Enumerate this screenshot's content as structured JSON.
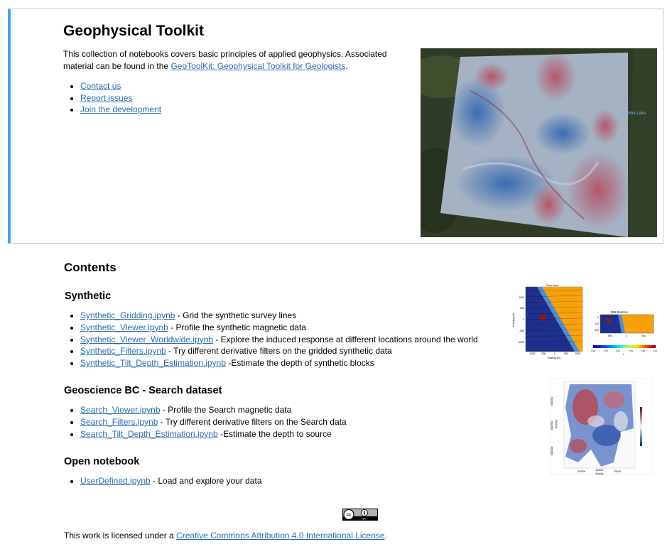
{
  "header": {
    "title": "Geophysical Toolkit",
    "intro_text": "This collection of notebooks covers basic principles of applied geophysics. Associated material can be found in the ",
    "intro_link": "GeoToolKit: Geophysical Toolkit for Geologists",
    "intro_end": ".",
    "links": [
      "Contact us",
      "Report issues",
      "Join the development"
    ],
    "hero_label": "Babine Lake"
  },
  "contents": {
    "title": "Contents",
    "sections": [
      {
        "title": "Synthetic",
        "items": [
          {
            "link": "Synthetic_Gridding.ipynb",
            "desc": " - Grid the synthetic survey lines"
          },
          {
            "link": "Synthetic_Viewer.ipynb",
            "desc": " - Profile the synthetic magnetic data"
          },
          {
            "link": "Synthetic_Viewer_Worldwide.ipynb",
            "desc": " - Explore the induced response at different locations around the world"
          },
          {
            "link": "Synthetic_Filters.ipynb",
            "desc": " - Try different derivative filters on the gridded synthetic data"
          },
          {
            "link": "Synthetic_Tilt_Depth_Estimation.ipynb",
            "desc": " -Estimate the depth of synthetic blocks"
          }
        ]
      },
      {
        "title": "Geoscience BC - Search dataset",
        "items": [
          {
            "link": "Search_Viewer.ipynb",
            "desc": " - Profile the Search magnetic data"
          },
          {
            "link": "Search_Filters.ipynb",
            "desc": " - Try different derivative filters on the Search data"
          },
          {
            "link": "Search_Tilt_Depth_Estimation.ipynb",
            "desc": " -Estimate the depth to source"
          }
        ]
      },
      {
        "title": "Open notebook",
        "items": [
          {
            "link": "UserDefined.ipynb",
            "desc": " - Load and explore your data"
          }
        ]
      }
    ]
  },
  "figures": {
    "synthetic": {
      "plan_title": "Plan view",
      "section_title": "EW Section",
      "plan_yticks": [
        "1000",
        "500",
        "0",
        "-500",
        "-1000"
      ],
      "plan_xticks": [
        "-1000",
        "-500",
        "0",
        "500",
        "1000"
      ],
      "xlabel": "Easting (m)",
      "ylabel": "Northing (m)",
      "section_yticks": [
        "0",
        "-100",
        "-200"
      ],
      "section_xticks": [
        "-500",
        "0",
        "500"
      ],
      "colorbar_ticks": [
        "0.00",
        "0.02",
        "0.04",
        "0.06",
        "0.08",
        "0.10"
      ],
      "colorbar_label": "K"
    },
    "search": {
      "yticks": [
        "6000000",
        "6015000",
        "6030000"
      ],
      "xticks": [
        "632500",
        "664000",
        "700000"
      ],
      "xlabel": "Easting",
      "ylabel": "Northing"
    }
  },
  "footer": {
    "cc_text": "cc",
    "by_text": "BY",
    "license_prefix": "This work is licensed under a ",
    "license_link": "Creative Commons Attribution 4.0 International License",
    "license_suffix": "."
  },
  "colors": {
    "accent_bar": "#42a5f5",
    "link": "#2a6db3",
    "magnetic_high": "#b04a5a",
    "magnetic_low": "#3d6fb0",
    "synthetic_block": "#f5a20a",
    "synthetic_background": "#1e2f8c"
  }
}
